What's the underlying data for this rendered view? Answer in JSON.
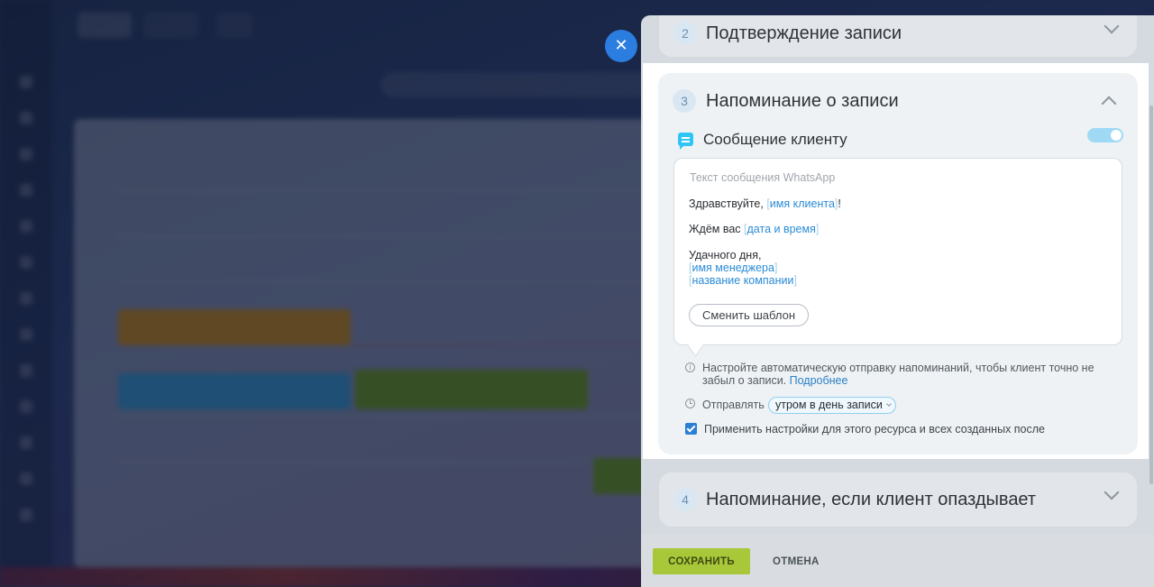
{
  "close_icon": "close-icon",
  "panel": {
    "section2": {
      "number": "2",
      "title": "Подтверждение записи"
    },
    "section3": {
      "number": "3",
      "title": "Напоминание о записи",
      "message_heading": "Сообщение клиенту",
      "message_box": {
        "label": "Текст сообщения WhatsApp",
        "line1_text": "Здравствуйте, ",
        "line1_var": "имя клиента",
        "line1_end": "!",
        "line2_text": "Ждём вас ",
        "line2_var": "дата и время",
        "line3_text": "Удачного дня,",
        "line4_var": "имя менеджера",
        "line5_var": "название компании",
        "change_template_button": "Сменить шаблон"
      },
      "info_text": "Настройте автоматическую отправку напоминаний, чтобы клиент точно не забыл о записи. ",
      "info_link": "Подробнее",
      "send_label": "Отправлять",
      "send_option": "утром в день записи",
      "apply_checked": true,
      "apply_label": "Применить настройки для этого ресурса и всех созданных после"
    },
    "section4": {
      "number": "4",
      "title": "Напоминание, если клиент опаздывает"
    }
  },
  "footer": {
    "save_label": "СОХРАНИТЬ",
    "cancel_label": "ОТМЕНА"
  },
  "colors": {
    "accent": "#2fc6f6",
    "save": "#a8c83a",
    "link": "#2a7fc9"
  }
}
